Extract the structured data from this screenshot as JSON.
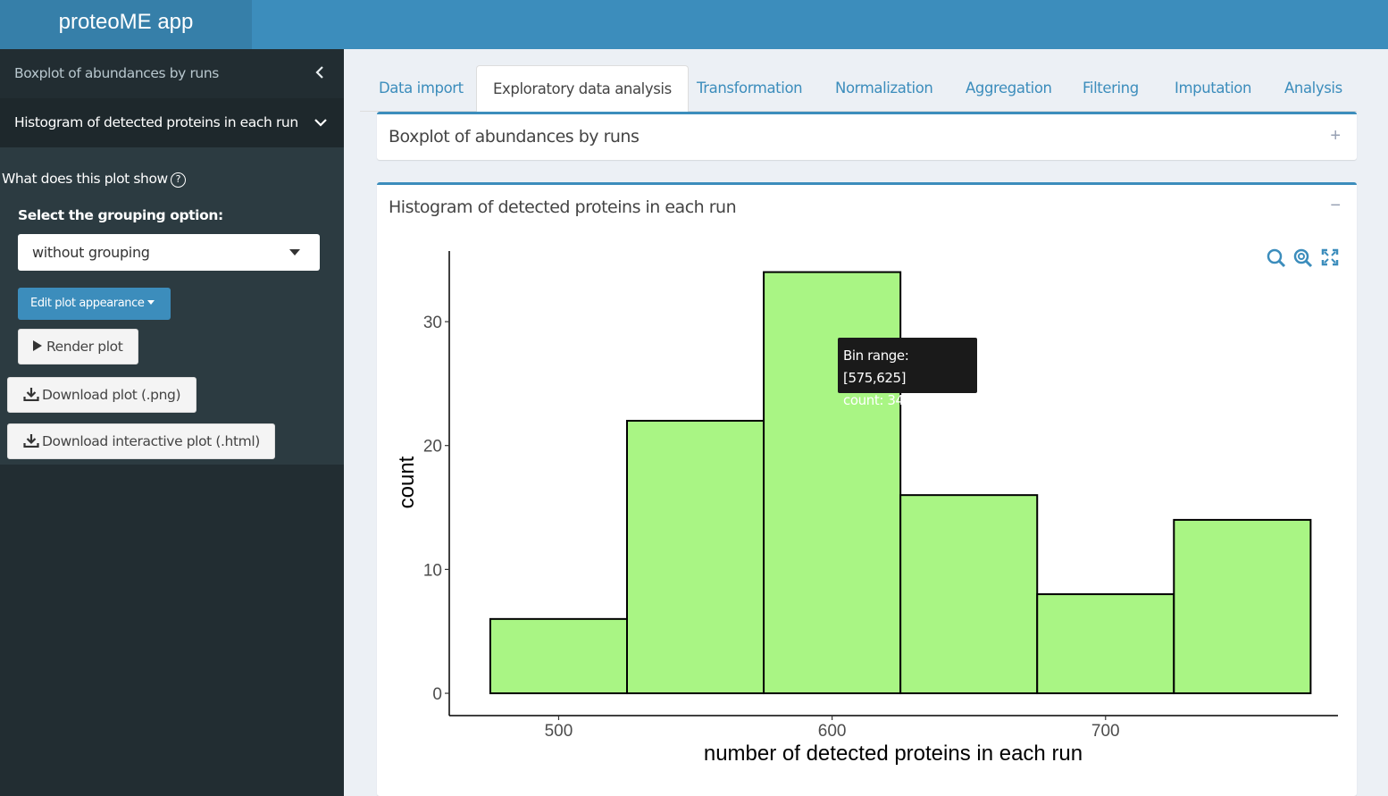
{
  "app": {
    "title": "proteoME app"
  },
  "sidebar": {
    "items": [
      {
        "label": "Boxplot of abundances by runs",
        "state": "collapsed"
      },
      {
        "label": "Histogram of detected proteins in each run",
        "state": "expanded"
      }
    ],
    "help_text": "What does this plot show",
    "help_icon": "?",
    "grouping_label": "Select the grouping option:",
    "grouping_value": "without grouping",
    "edit_button": "Edit plot appearance",
    "render_button": "Render plot",
    "download_png": "Download plot (.png)",
    "download_html": "Download interactive plot (.html)"
  },
  "tabs": [
    "Data import",
    "Exploratory data analysis",
    "Transformation",
    "Normalization",
    "Aggregation",
    "Filtering",
    "Imputation",
    "Analysis"
  ],
  "active_tab": "Exploratory data analysis",
  "boxes": [
    {
      "title": "Boxplot of abundances by runs",
      "tool": "+"
    },
    {
      "title": "Histogram of detected proteins in each run",
      "tool": "−"
    }
  ],
  "tooltip": {
    "line1": "Bin range: [575,625]",
    "line2": "count: 34"
  },
  "colors": {
    "header": "#3c8dbc",
    "logo": "#367fa9",
    "sidebar": "#222d32",
    "bar_fill": "#a9f584",
    "accent": "#3c8dbc"
  },
  "chart_data": {
    "type": "bar",
    "bins": [
      [
        475,
        525
      ],
      [
        525,
        575
      ],
      [
        575,
        625
      ],
      [
        625,
        675
      ],
      [
        675,
        725
      ],
      [
        725,
        775
      ]
    ],
    "values": [
      6,
      22,
      34,
      16,
      8,
      14
    ],
    "xlabel": "number of detected proteins in each run",
    "ylabel": "count",
    "xticks": [
      500,
      600,
      700
    ],
    "yticks": [
      0,
      10,
      20,
      30
    ],
    "xlim": [
      460,
      785
    ],
    "ylim": [
      -1.8,
      35.7
    ],
    "grid": false,
    "legend": "none"
  }
}
